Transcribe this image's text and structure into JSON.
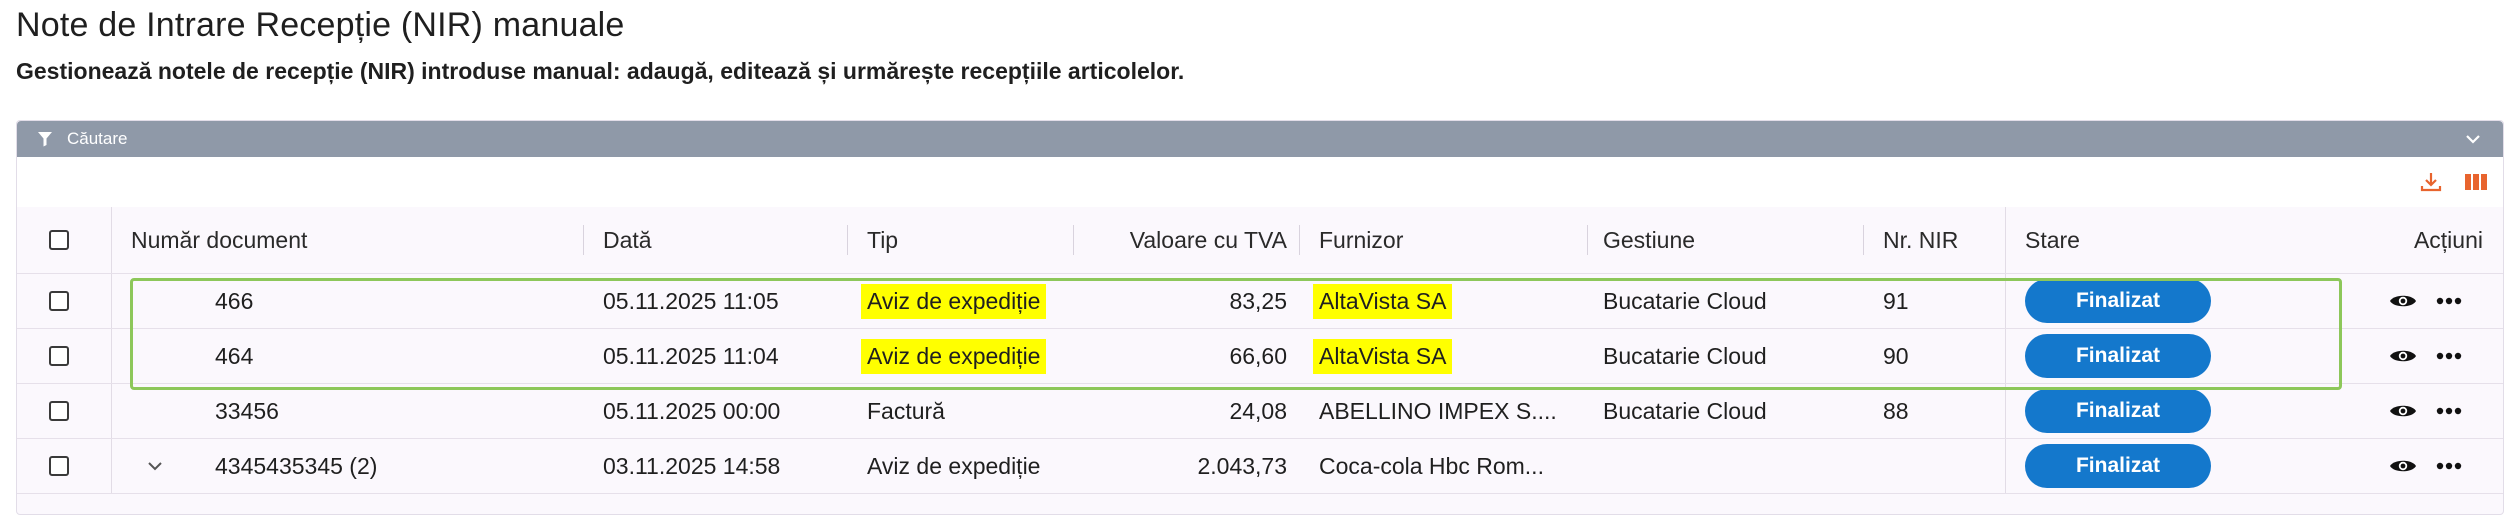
{
  "page": {
    "title": "Note de Intrare Recepție (NIR) manuale",
    "subtitle": "Gestionează notele de recepție (NIR) introduse manual: adaugă, editează și urmărește recepțiile articolelor."
  },
  "search": {
    "label": "Căutare"
  },
  "toolbar": {
    "download_icon": "download-icon",
    "columns_icon": "columns-icon",
    "accent": "#e8642e"
  },
  "table": {
    "columns": [
      "Număr document",
      "Dată",
      "Tip",
      "Valoare cu TVA",
      "Furnizor",
      "Gestiune",
      "Nr. NIR",
      "Stare",
      "Acțiuni"
    ],
    "rows": [
      {
        "doc": "466",
        "date": "05.11.2025 11:05",
        "type": "Aviz de expediție",
        "value": "83,25",
        "supplier": "AltaVista SA",
        "store": "Bucatarie Cloud",
        "nir": "91",
        "status": "Finalizat",
        "highlight": true
      },
      {
        "doc": "464",
        "date": "05.11.2025 11:04",
        "type": "Aviz de expediție",
        "value": "66,60",
        "supplier": "AltaVista SA",
        "store": "Bucatarie Cloud",
        "nir": "90",
        "status": "Finalizat",
        "highlight": true
      },
      {
        "doc": "33456",
        "date": "05.11.2025 00:00",
        "type": "Factură",
        "value": "24,08",
        "supplier": "ABELLINO IMPEX S....",
        "store": "Bucatarie Cloud",
        "nir": "88",
        "status": "Finalizat",
        "highlight": false
      },
      {
        "doc": "4345435345 (2)",
        "date": "03.11.2025 14:58",
        "type": "Aviz de expediție",
        "value": "2.043,73",
        "supplier": "Coca-cola Hbc Rom...",
        "store": "",
        "nir": "",
        "status": "Finalizat",
        "highlight": false,
        "expandable": true
      }
    ]
  },
  "colors": {
    "header_bar": "#8f99a8",
    "status_button": "#1478cc",
    "highlight": "#ffff00",
    "annotation_box": "#8dc75a"
  }
}
